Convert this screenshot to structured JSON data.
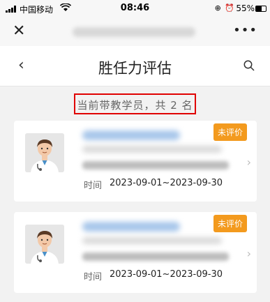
{
  "status_bar": {
    "carrier": "中国移动",
    "time": "08:46",
    "battery": "55%",
    "icons": [
      "signal-icon",
      "wifi-icon",
      "lock-icon",
      "alarm-icon",
      "battery-icon"
    ]
  },
  "wx_bar": {
    "close_symbol": "✕",
    "more_symbol": "•••"
  },
  "nav": {
    "back_symbol": "‹",
    "title": "胜任力评估"
  },
  "summary": "当前带教学员，共 2 名",
  "cards": [
    {
      "badge": "未评价",
      "time_label": "时间",
      "time_value": "2023-09-01~2023-09-30"
    },
    {
      "badge": "未评价",
      "time_label": "时间",
      "time_value": "2023-09-01~2023-09-30"
    }
  ],
  "colors": {
    "badge": "#f39a1e",
    "highlight_border": "#e00000",
    "background": "#f2f2f2"
  }
}
